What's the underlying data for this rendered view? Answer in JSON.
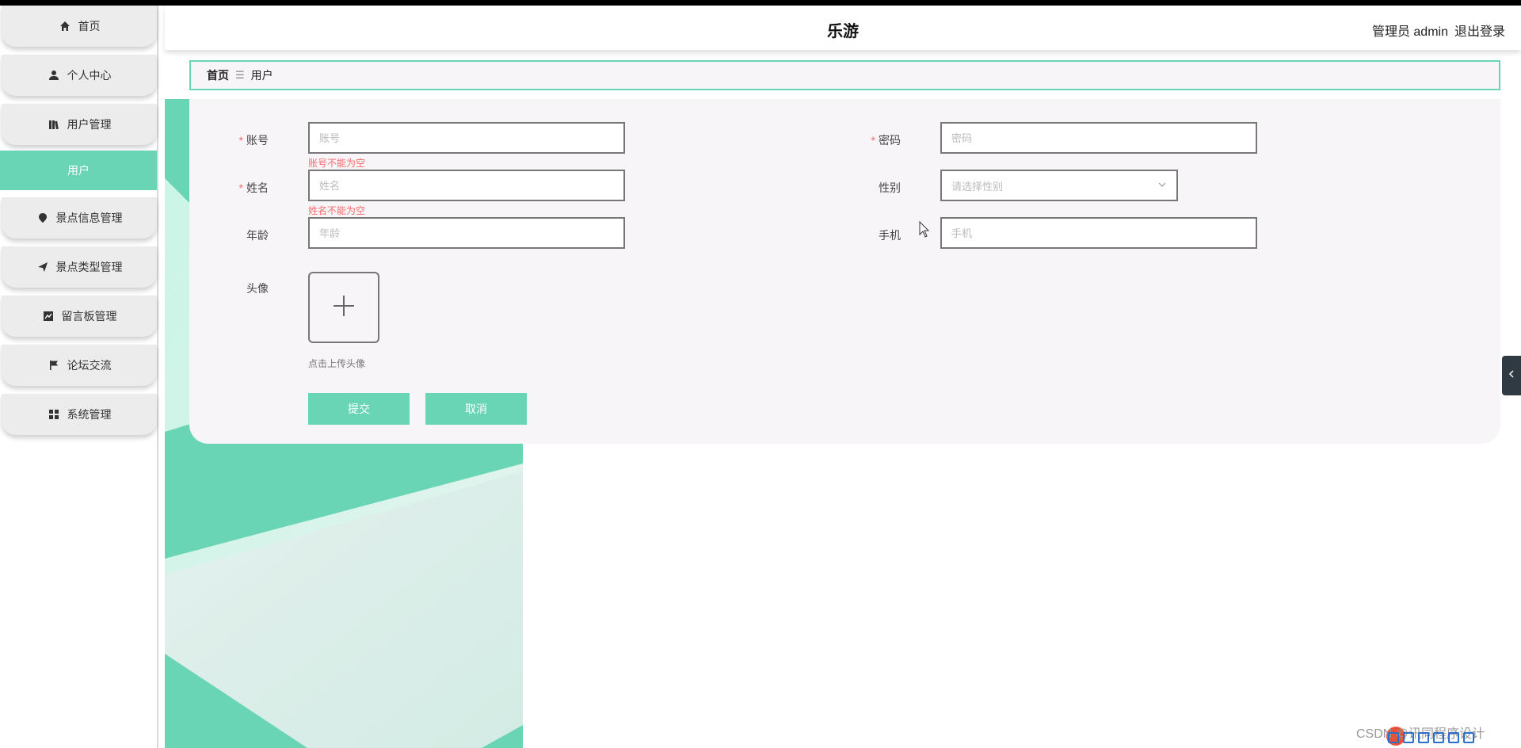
{
  "header": {
    "title": "乐游",
    "user_label": "管理员 admin",
    "logout_label": "退出登录"
  },
  "sidebar": {
    "items": [
      {
        "label": "首页",
        "icon": "home-icon"
      },
      {
        "label": "个人中心",
        "icon": "person-icon"
      },
      {
        "label": "用户管理",
        "icon": "books-icon"
      },
      {
        "label": "用户",
        "icon": ""
      },
      {
        "label": "景点信息管理",
        "icon": "location-pin-icon"
      },
      {
        "label": "景点类型管理",
        "icon": "paper-plane-icon"
      },
      {
        "label": "留言板管理",
        "icon": "line-chart-icon"
      },
      {
        "label": "论坛交流",
        "icon": "flag-icon"
      },
      {
        "label": "系统管理",
        "icon": "grid-icon"
      }
    ]
  },
  "breadcrumb": {
    "home": "首页",
    "separator": "☰",
    "current": "用户"
  },
  "form": {
    "account": {
      "label": "账号",
      "placeholder": "账号",
      "error": "账号不能为空"
    },
    "password": {
      "label": "密码",
      "placeholder": "密码"
    },
    "name": {
      "label": "姓名",
      "placeholder": "姓名",
      "error": "姓名不能为空"
    },
    "gender": {
      "label": "性别",
      "placeholder": "请选择性别"
    },
    "age": {
      "label": "年龄",
      "placeholder": "年龄"
    },
    "phone": {
      "label": "手机",
      "placeholder": "手机"
    },
    "avatar": {
      "label": "头像",
      "hint": "点击上传头像"
    },
    "required_mark": "*",
    "submit_label": "提交",
    "cancel_label": "取消"
  },
  "watermark": "CSDN @讯同程序设计",
  "colors": {
    "accent": "#6ad5b4",
    "error": "#f56c6c",
    "card_bg": "#f8f5f8"
  }
}
